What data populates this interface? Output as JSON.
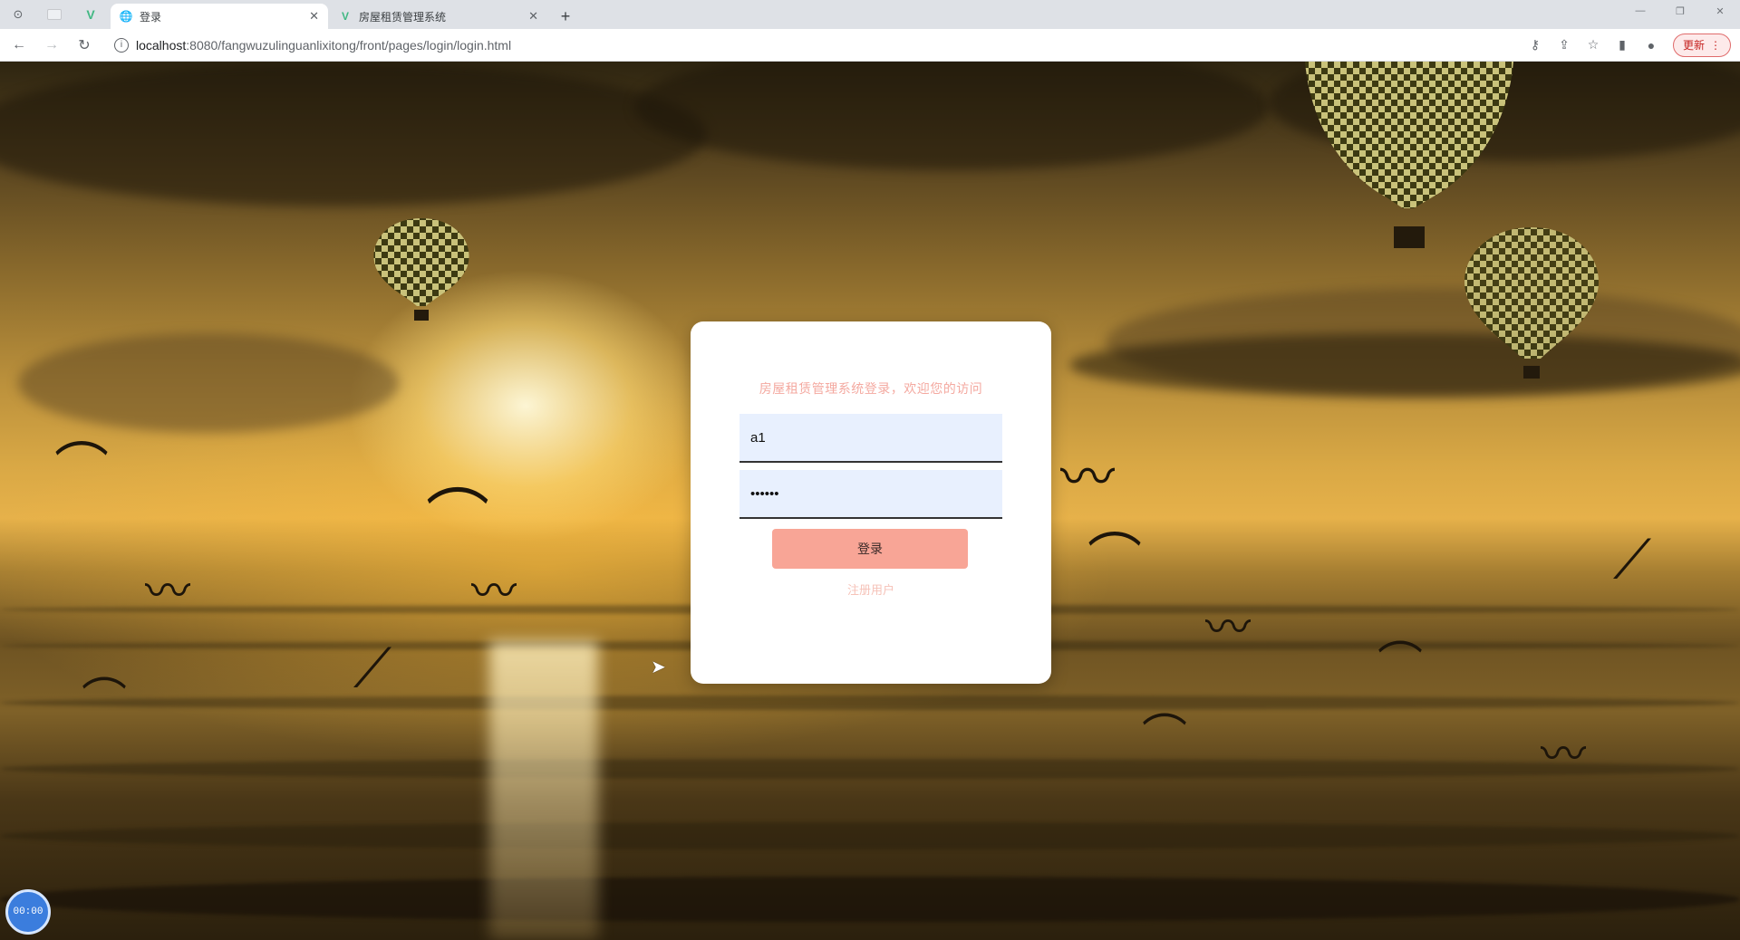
{
  "browser": {
    "tabs": [
      {
        "title": "",
        "active": false,
        "icon": "vue-icon"
      },
      {
        "title": "登录",
        "active": true,
        "icon": "globe-icon"
      },
      {
        "title": "房屋租赁管理系统",
        "active": false,
        "icon": "vue-icon"
      }
    ],
    "address": {
      "host": "localhost",
      "path": ":8080/fangwuzulinguanlixitong/front/pages/login/login.html"
    },
    "update_label": "更新"
  },
  "login": {
    "title": "房屋租赁管理系统登录，欢迎您的访问",
    "username_value": "a1",
    "password_value": "••••••",
    "submit_label": "登录",
    "register_label": "注册用户"
  },
  "overlay": {
    "badge_text": "00:00"
  },
  "colors": {
    "accent": "#f8a596",
    "title_pink": "#f4a9a0",
    "input_bg": "#e8f0fe"
  }
}
